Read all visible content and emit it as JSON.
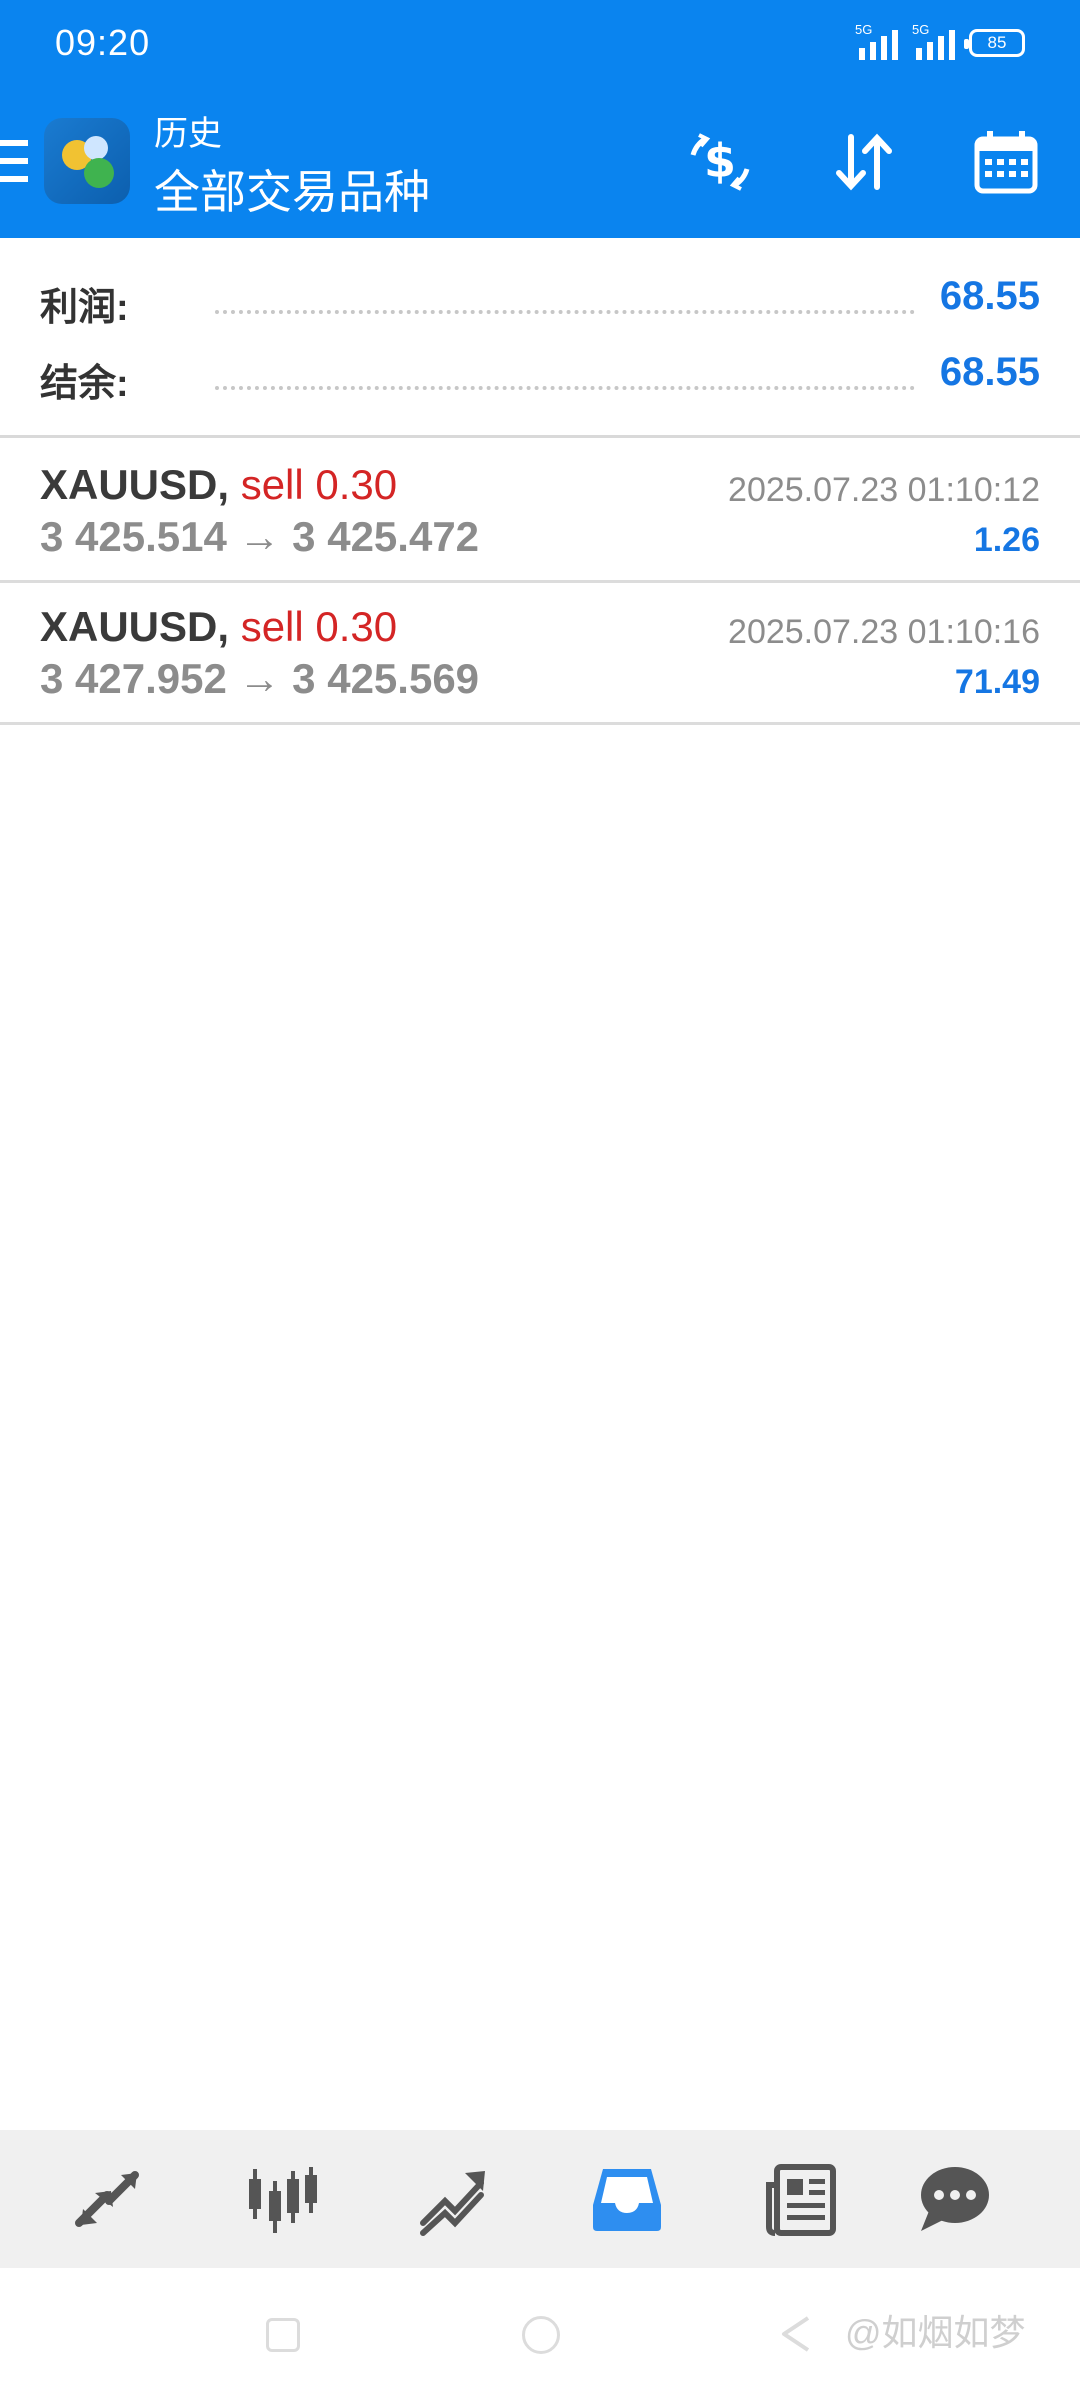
{
  "status_bar": {
    "time": "09:20",
    "signal1_tag": "5G",
    "signal2_tag": "5G",
    "battery": "85"
  },
  "app_bar": {
    "title_small": "历史",
    "title_big": "全部交易品种",
    "icons": [
      "menu-icon",
      "metatrader-logo",
      "currency-icon",
      "sort-icon",
      "calendar-icon"
    ]
  },
  "summary": {
    "profit_label": "利润:",
    "profit_value": "68.55",
    "balance_label": "结余:",
    "balance_value": "68.55"
  },
  "trades": [
    {
      "symbol": "XAUUSD,",
      "side": "sell 0.30",
      "prices": "3 425.514 → 3 425.472",
      "time": "2025.07.23 01:10:12",
      "profit": "1.26"
    },
    {
      "symbol": "XAUUSD,",
      "side": "sell 0.30",
      "prices": "3 427.952 → 3 425.569",
      "time": "2025.07.23 01:10:16",
      "profit": "71.49"
    }
  ],
  "bottom_nav": {
    "items": [
      "quotes-icon",
      "chart-icon",
      "trade-icon",
      "history-icon",
      "news-icon",
      "chat-icon"
    ],
    "active": "history-icon"
  },
  "system_nav": {
    "watermark": "@如烟如梦"
  },
  "colors": {
    "primary": "#0a84ef",
    "profit_blue": "#1576e3",
    "sell_red": "#d42525",
    "text_gray": "#8c8c8c"
  }
}
